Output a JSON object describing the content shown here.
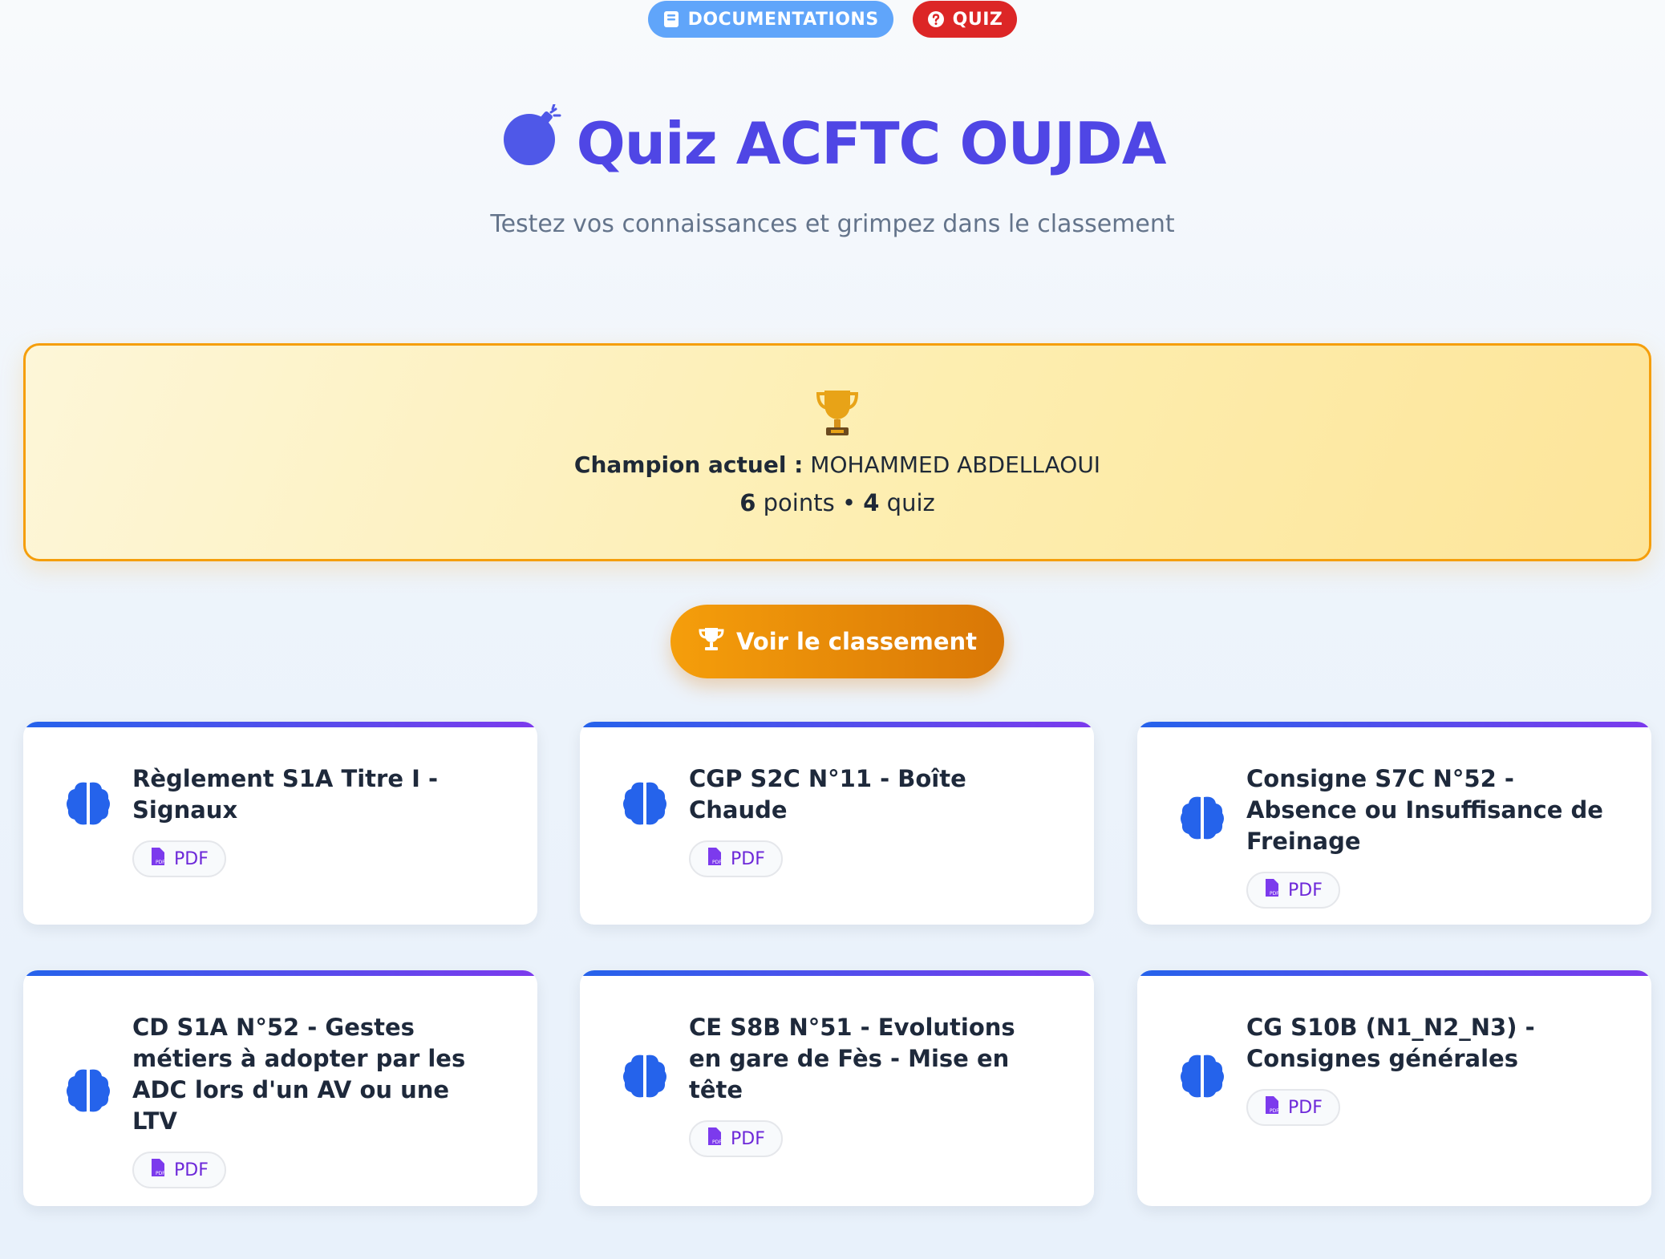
{
  "nav": {
    "doc_label": "DOCUMENTATIONS",
    "quiz_label": "QUIZ"
  },
  "hero": {
    "title": "Quiz ACFTC OUJDA",
    "subtitle": "Testez vos connaissances et grimpez dans le classement"
  },
  "champion": {
    "label": "Champion actuel :",
    "name": "MOHAMMED ABDELLAOUI",
    "points": "6",
    "points_unit": "points",
    "separator": "•",
    "quiz_count": "4",
    "quiz_unit": "quiz"
  },
  "ranking_button": "Voir le classement",
  "cards": [
    {
      "title": "Règlement S1A Titre I - Signaux",
      "pdf_label": "PDF"
    },
    {
      "title": "CGP S2C N°11 - Boîte Chaude",
      "pdf_label": "PDF"
    },
    {
      "title": "Consigne S7C N°52 - Absence ou Insuffisance de Freinage",
      "pdf_label": "PDF"
    },
    {
      "title": "CD S1A N°52 - Gestes métiers à adopter par les ADC lors d'un AV ou une LTV",
      "pdf_label": "PDF"
    },
    {
      "title": "CE S8B N°51 - Evolutions en gare de Fès - Mise en tête",
      "pdf_label": "PDF"
    },
    {
      "title": "CG S10B (N1_N2_N3) - Consignes générales",
      "pdf_label": "PDF"
    }
  ],
  "colors": {
    "title": "#4f46e5",
    "doc_pill": "#60a5fa",
    "quiz_pill": "#dc2626",
    "champion_border": "#f59e0b",
    "rank_button": "#f59e0b",
    "brain_icon": "#2563eb",
    "pdf_text": "#6d28d9"
  },
  "icons": {
    "nav_doc": "book-icon",
    "nav_quiz": "question-circle-icon",
    "hero": "bomb-icon",
    "champion": "trophy-icon",
    "ranking": "trophy-icon",
    "card": "brain-icon",
    "pdf": "file-pdf-icon"
  }
}
